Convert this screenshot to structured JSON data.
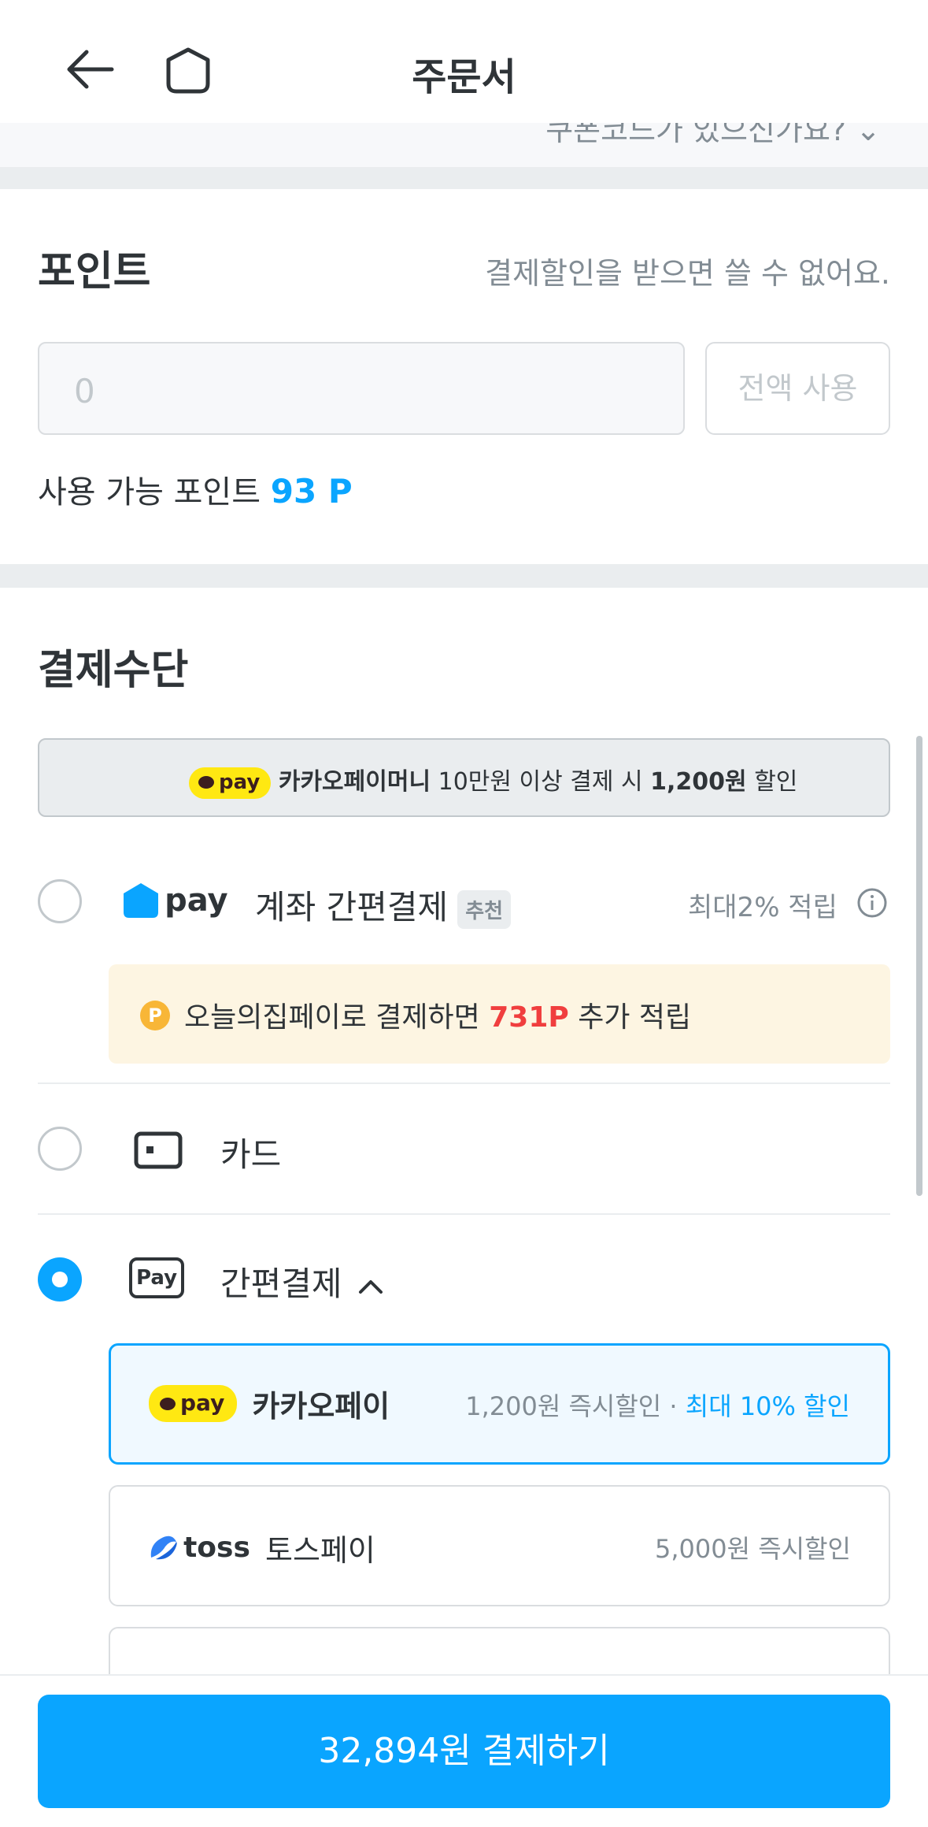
{
  "header": {
    "title": "주문서"
  },
  "coupon_peek": {
    "text": "쿠폰코드가 있으신가요? ⌄"
  },
  "points": {
    "title": "포인트",
    "note": "결제할인을 받으면 쓸 수 없어요.",
    "input_value": "0",
    "use_all_label": "전액 사용",
    "available_label": "사용 가능 포인트",
    "available_value": "93 P"
  },
  "payment": {
    "title": "결제수단",
    "banner": {
      "badge": "pay",
      "brand": "카카오페이머니",
      "text_mid": "10만원 이상 결제 시",
      "amount": "1,200원",
      "text_end": "할인"
    },
    "ohouse_pay": {
      "logo_text": "pay",
      "label": "계좌 간편결제",
      "tag": "추천",
      "reward": "최대2% 적립",
      "notice_prefix": "오늘의집페이로 결제하면",
      "notice_points": "731P",
      "notice_suffix": "추가 적립",
      "coin": "P"
    },
    "card": {
      "label": "카드"
    },
    "easy_pay": {
      "icon_text": "Pay",
      "label": "간편결제",
      "options": [
        {
          "badge": "pay",
          "name": "카카오페이",
          "discount": "1,200원 즉시할인",
          "separator": "·",
          "extra": "최대 10% 할인"
        },
        {
          "logo": "toss",
          "name": "토스페이",
          "discount": "5,000원 즉시할인"
        }
      ]
    }
  },
  "pay_button": {
    "label": "32,894원 결제하기"
  },
  "colors": {
    "accent": "#0aa5ff",
    "kakao_yellow": "#ffe812",
    "red": "#f03e3e"
  }
}
